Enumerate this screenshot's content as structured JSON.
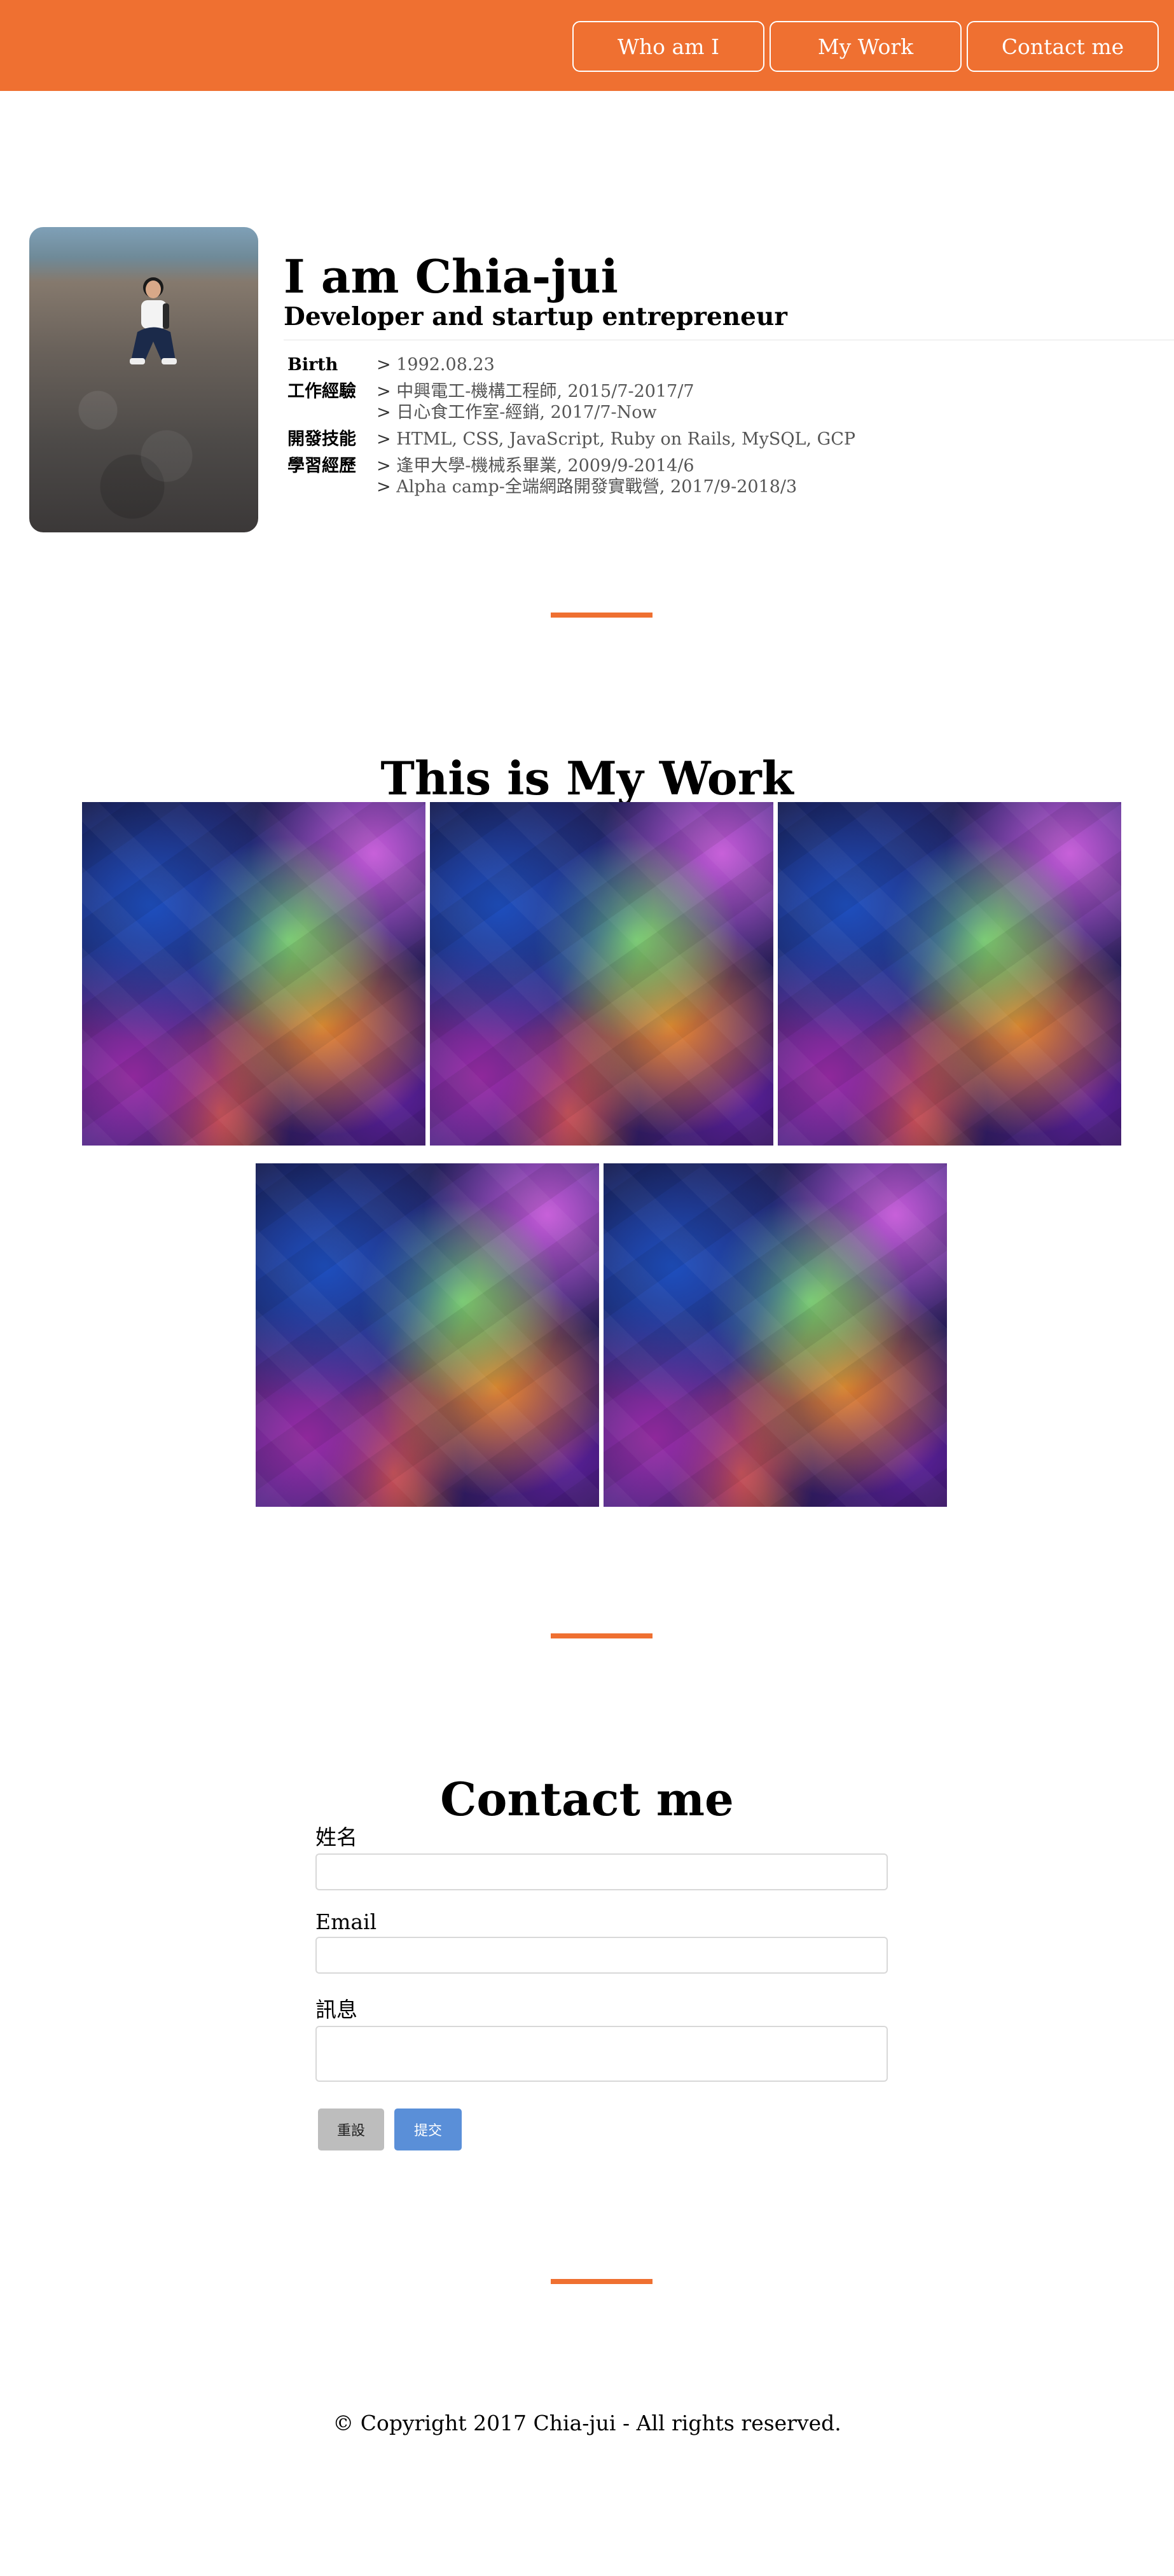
{
  "nav": {
    "items": [
      "Who am I",
      "My Work",
      "Contact me"
    ]
  },
  "about": {
    "name": "I am Chia-jui",
    "tagline": "Developer and startup entrepreneur",
    "info": [
      {
        "key": "Birth",
        "values": [
          "1992.08.23"
        ]
      },
      {
        "key": "工作經驗",
        "values": [
          "中興電工-機構工程師, 2015/7-2017/7",
          "日心食工作室-經銷, 2017/7-Now"
        ]
      },
      {
        "key": "開發技能",
        "values": [
          "HTML, CSS, JavaScript, Ruby on Rails, MySQL, GCP"
        ]
      },
      {
        "key": "學習經歷",
        "values": [
          "逢甲大學-機械系畢業, 2009/9-2014/6",
          "Alpha camp-全端網路開發實戰營, 2017/9-2018/3"
        ]
      }
    ]
  },
  "work": {
    "title": "This is My Work",
    "tile_count": 5
  },
  "contact": {
    "title": "Contact me",
    "name_label": "姓名",
    "email_label": "Email",
    "message_label": "訊息",
    "reset_label": "重設",
    "submit_label": "提交"
  },
  "footer": {
    "copyright": "© Copyright 2017 Chia-jui - All rights reserved."
  },
  "colors": {
    "accent": "#ef7031",
    "submit": "#5a8fd8",
    "reset": "#bdbdbd"
  }
}
